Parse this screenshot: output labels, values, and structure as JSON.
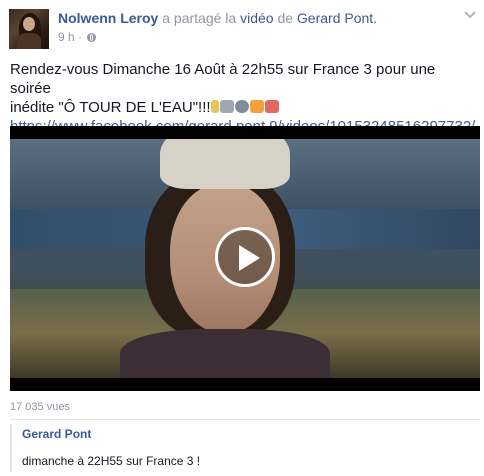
{
  "post": {
    "actor_name": "Nolwenn Leroy",
    "action_text": "a partagé la",
    "object_link": "vidéo",
    "preposition": "de",
    "source_page": "Gerard Pont.",
    "timestamp": "9 h",
    "timestamp_separator": "·",
    "privacy_icon": "globe-icon",
    "menu_icon": "chevron-down-icon",
    "text_line_1": "Rendez-vous Dimanche 16 Août à 22h55 sur France 3 pour une soirée",
    "text_line_2": "inédite \"Ô TOUR DE L'EAU\"!!!",
    "emoji_icons": [
      "info-icon",
      "car-icon",
      "globe-icon",
      "fish-icon",
      "octopus-icon"
    ],
    "url": "https://www.facebook.com/gerard.pont.9/videos/10153248516297732/"
  },
  "video": {
    "play_icon": "play-icon",
    "views": "17 035 vues"
  },
  "shared": {
    "source_name": "Gerard Pont",
    "source_text": "dimanche à 22H55 sur France 3 !"
  },
  "colors": {
    "link": "#3b5998",
    "muted": "#9197a3",
    "text": "#141823"
  }
}
